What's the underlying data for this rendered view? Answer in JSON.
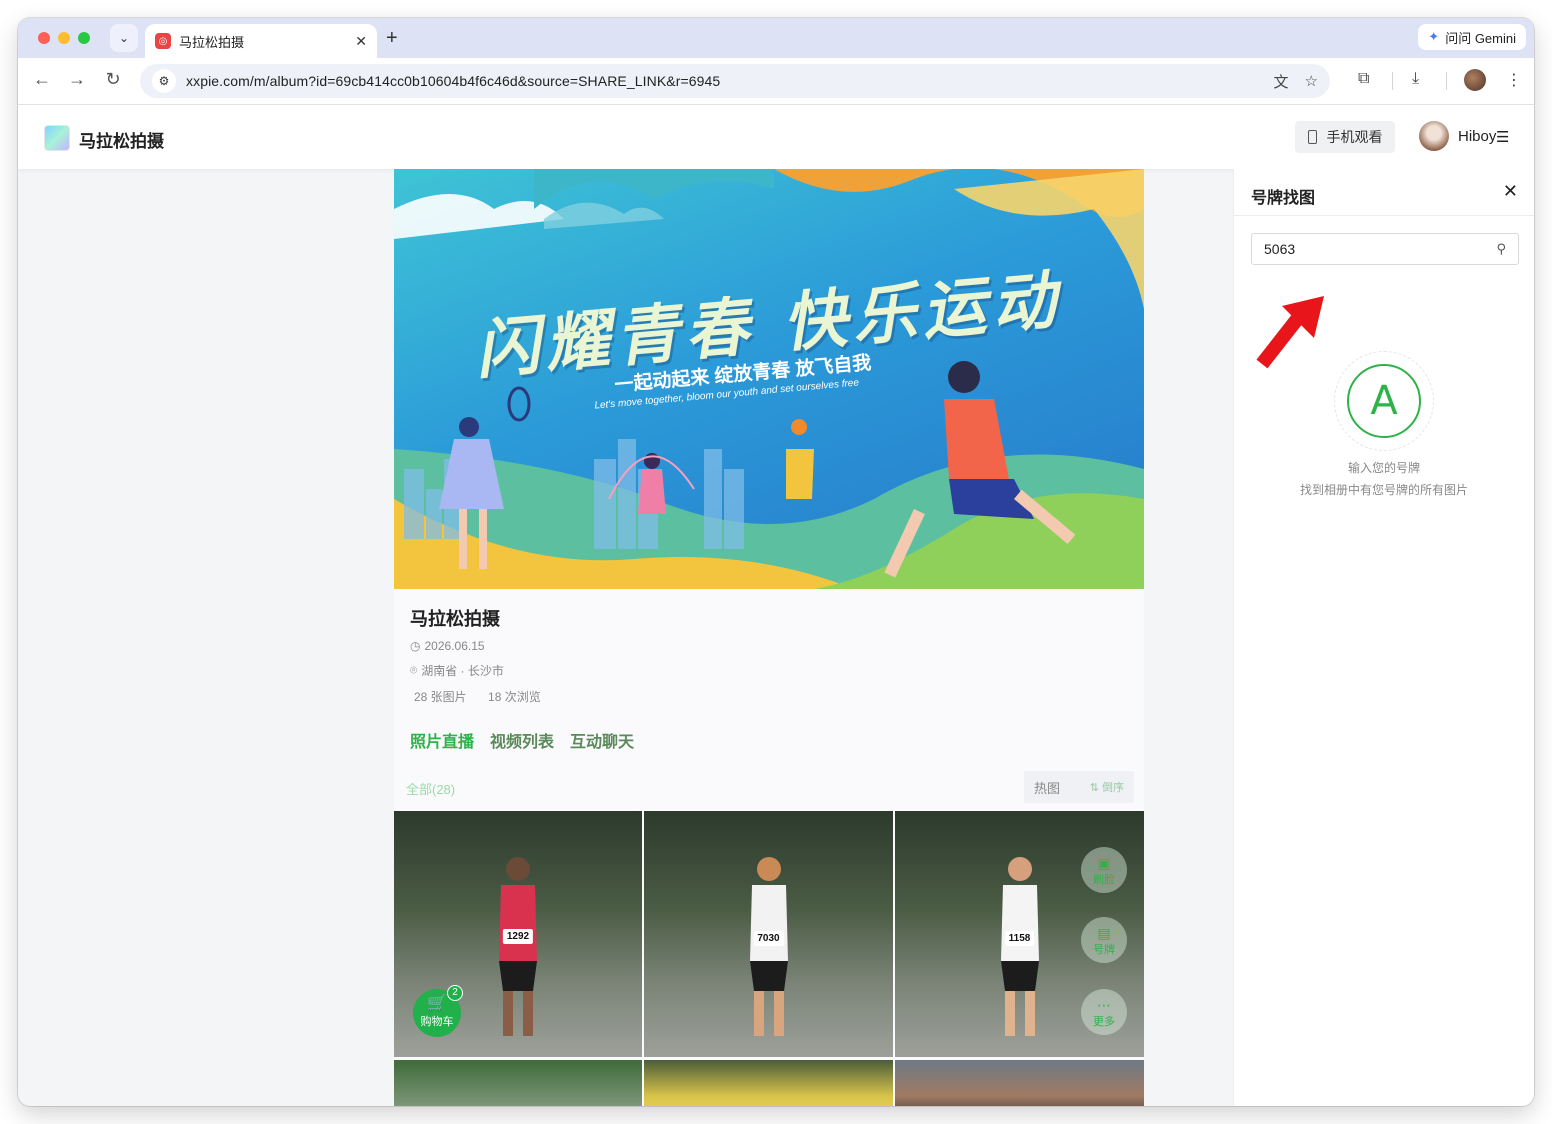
{
  "browser": {
    "tab_title": "马拉松拍摄",
    "new_tab": "+",
    "gemini_label": "问问 Gemini",
    "url": "xxpie.com/m/album?id=69cb414cc0b10604b4f6c46d&source=SHARE_LINK&r=6945"
  },
  "header": {
    "site_title": "马拉松拍摄",
    "mobile_view_label": "手机观看",
    "user_name": "Hiboy",
    "user_menu": "☰"
  },
  "banner": {
    "title": "闪耀青春 快乐运动",
    "subtitle": "一起动起来 绽放青春 放飞自我",
    "subtitle_en": "Let's move together, bloom our youth and set ourselves free"
  },
  "album": {
    "title": "马拉松拍摄",
    "date": "2026.06.15",
    "location": "湖南省 · 长沙市",
    "photo_count": "28 张图片",
    "view_count": "18 次浏览"
  },
  "tabs": [
    "照片直播",
    "视频列表",
    "互动聊天"
  ],
  "filter": {
    "all_label": "全部(28)",
    "hot_label": "热图",
    "sort_label": "倒序"
  },
  "photos": [
    {
      "bib": "1292"
    },
    {
      "bib": "7030"
    },
    {
      "bib": "1158"
    }
  ],
  "cart": {
    "label": "购物车",
    "count": "2"
  },
  "float_buttons": {
    "face": "刷脸",
    "bib": "号牌",
    "more": "更多"
  },
  "side_panel": {
    "title": "号牌找图",
    "search_value": "5063",
    "empty_icon_letter": "A",
    "empty_line1": "输入您的号牌",
    "empty_line2": "找到相册中有您号牌的所有图片"
  },
  "colors": {
    "accent_green": "#2fb24a",
    "arrow_red": "#e8161b"
  }
}
